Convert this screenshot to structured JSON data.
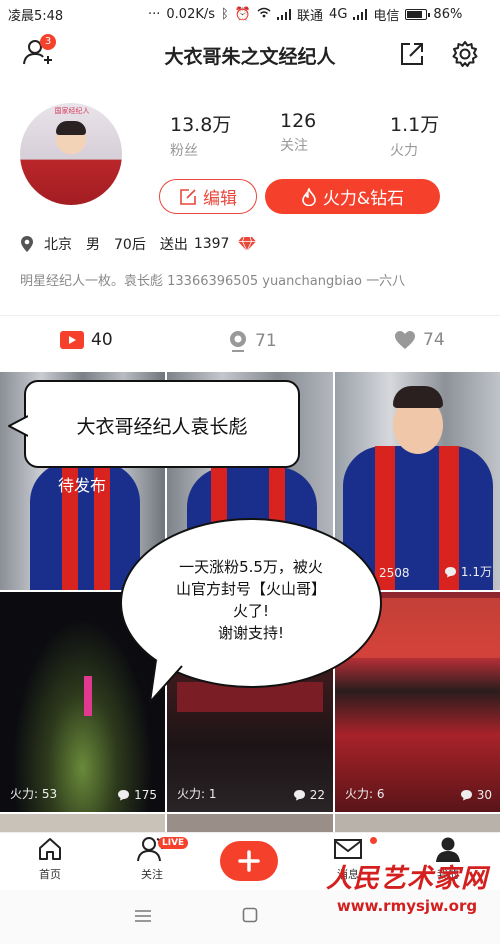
{
  "status_bar": {
    "time": "凌晨5:48",
    "dots": "···",
    "speed": "0.02K/s",
    "carrier1": "联通",
    "network": "4G",
    "carrier2": "电信",
    "battery": "86%",
    "battery_level": 0.86
  },
  "header": {
    "title": "大衣哥朱之文经纪人",
    "notification_count": "3",
    "avatar_sign_text": "国家经纪人"
  },
  "profile": {
    "stats": [
      {
        "value": "13.8万",
        "label": "粉丝"
      },
      {
        "value": "126",
        "label": "关注"
      },
      {
        "value": "1.1万",
        "label": "火力"
      }
    ],
    "edit_label": "编辑",
    "fire_label": "火力&钻石",
    "city": "北京",
    "gender": "男",
    "age": "70后",
    "gift_label": "送出",
    "gift_count": "1397",
    "bio": "明星经纪人一枚。袁长彪 13366396505 yuanchangbiao 一六八"
  },
  "tabs": [
    {
      "count": "40",
      "icon": "video-icon"
    },
    {
      "count": "71",
      "icon": "camera-icon"
    },
    {
      "count": "74",
      "icon": "heart-icon"
    }
  ],
  "grid": {
    "pending_label": "待发布",
    "cells": [
      {
        "top": "2508",
        "comments": "1.1万"
      },
      {
        "fire": "火力: 53",
        "comments": "175"
      },
      {
        "fire": "火力: 1",
        "comments": "22"
      },
      {
        "fire": "火力: 6",
        "comments": "30"
      }
    ]
  },
  "bubbles": {
    "top": "大衣哥经纪人袁长彪",
    "middle": [
      "一天涨粉5.5万，被火",
      "山官方封号【火山哥】",
      "火了!",
      "谢谢支持!"
    ]
  },
  "bottom_nav": {
    "home": "首页",
    "follow": "关注",
    "live": "LIVE",
    "messages": "消息",
    "me": "我的"
  },
  "watermark": {
    "cn": "人民艺术家网",
    "url": "www.rmysjw.org"
  },
  "colors": {
    "accent": "#f5402c",
    "coat": "#1a2f8c",
    "scarf": "#d8231f"
  }
}
